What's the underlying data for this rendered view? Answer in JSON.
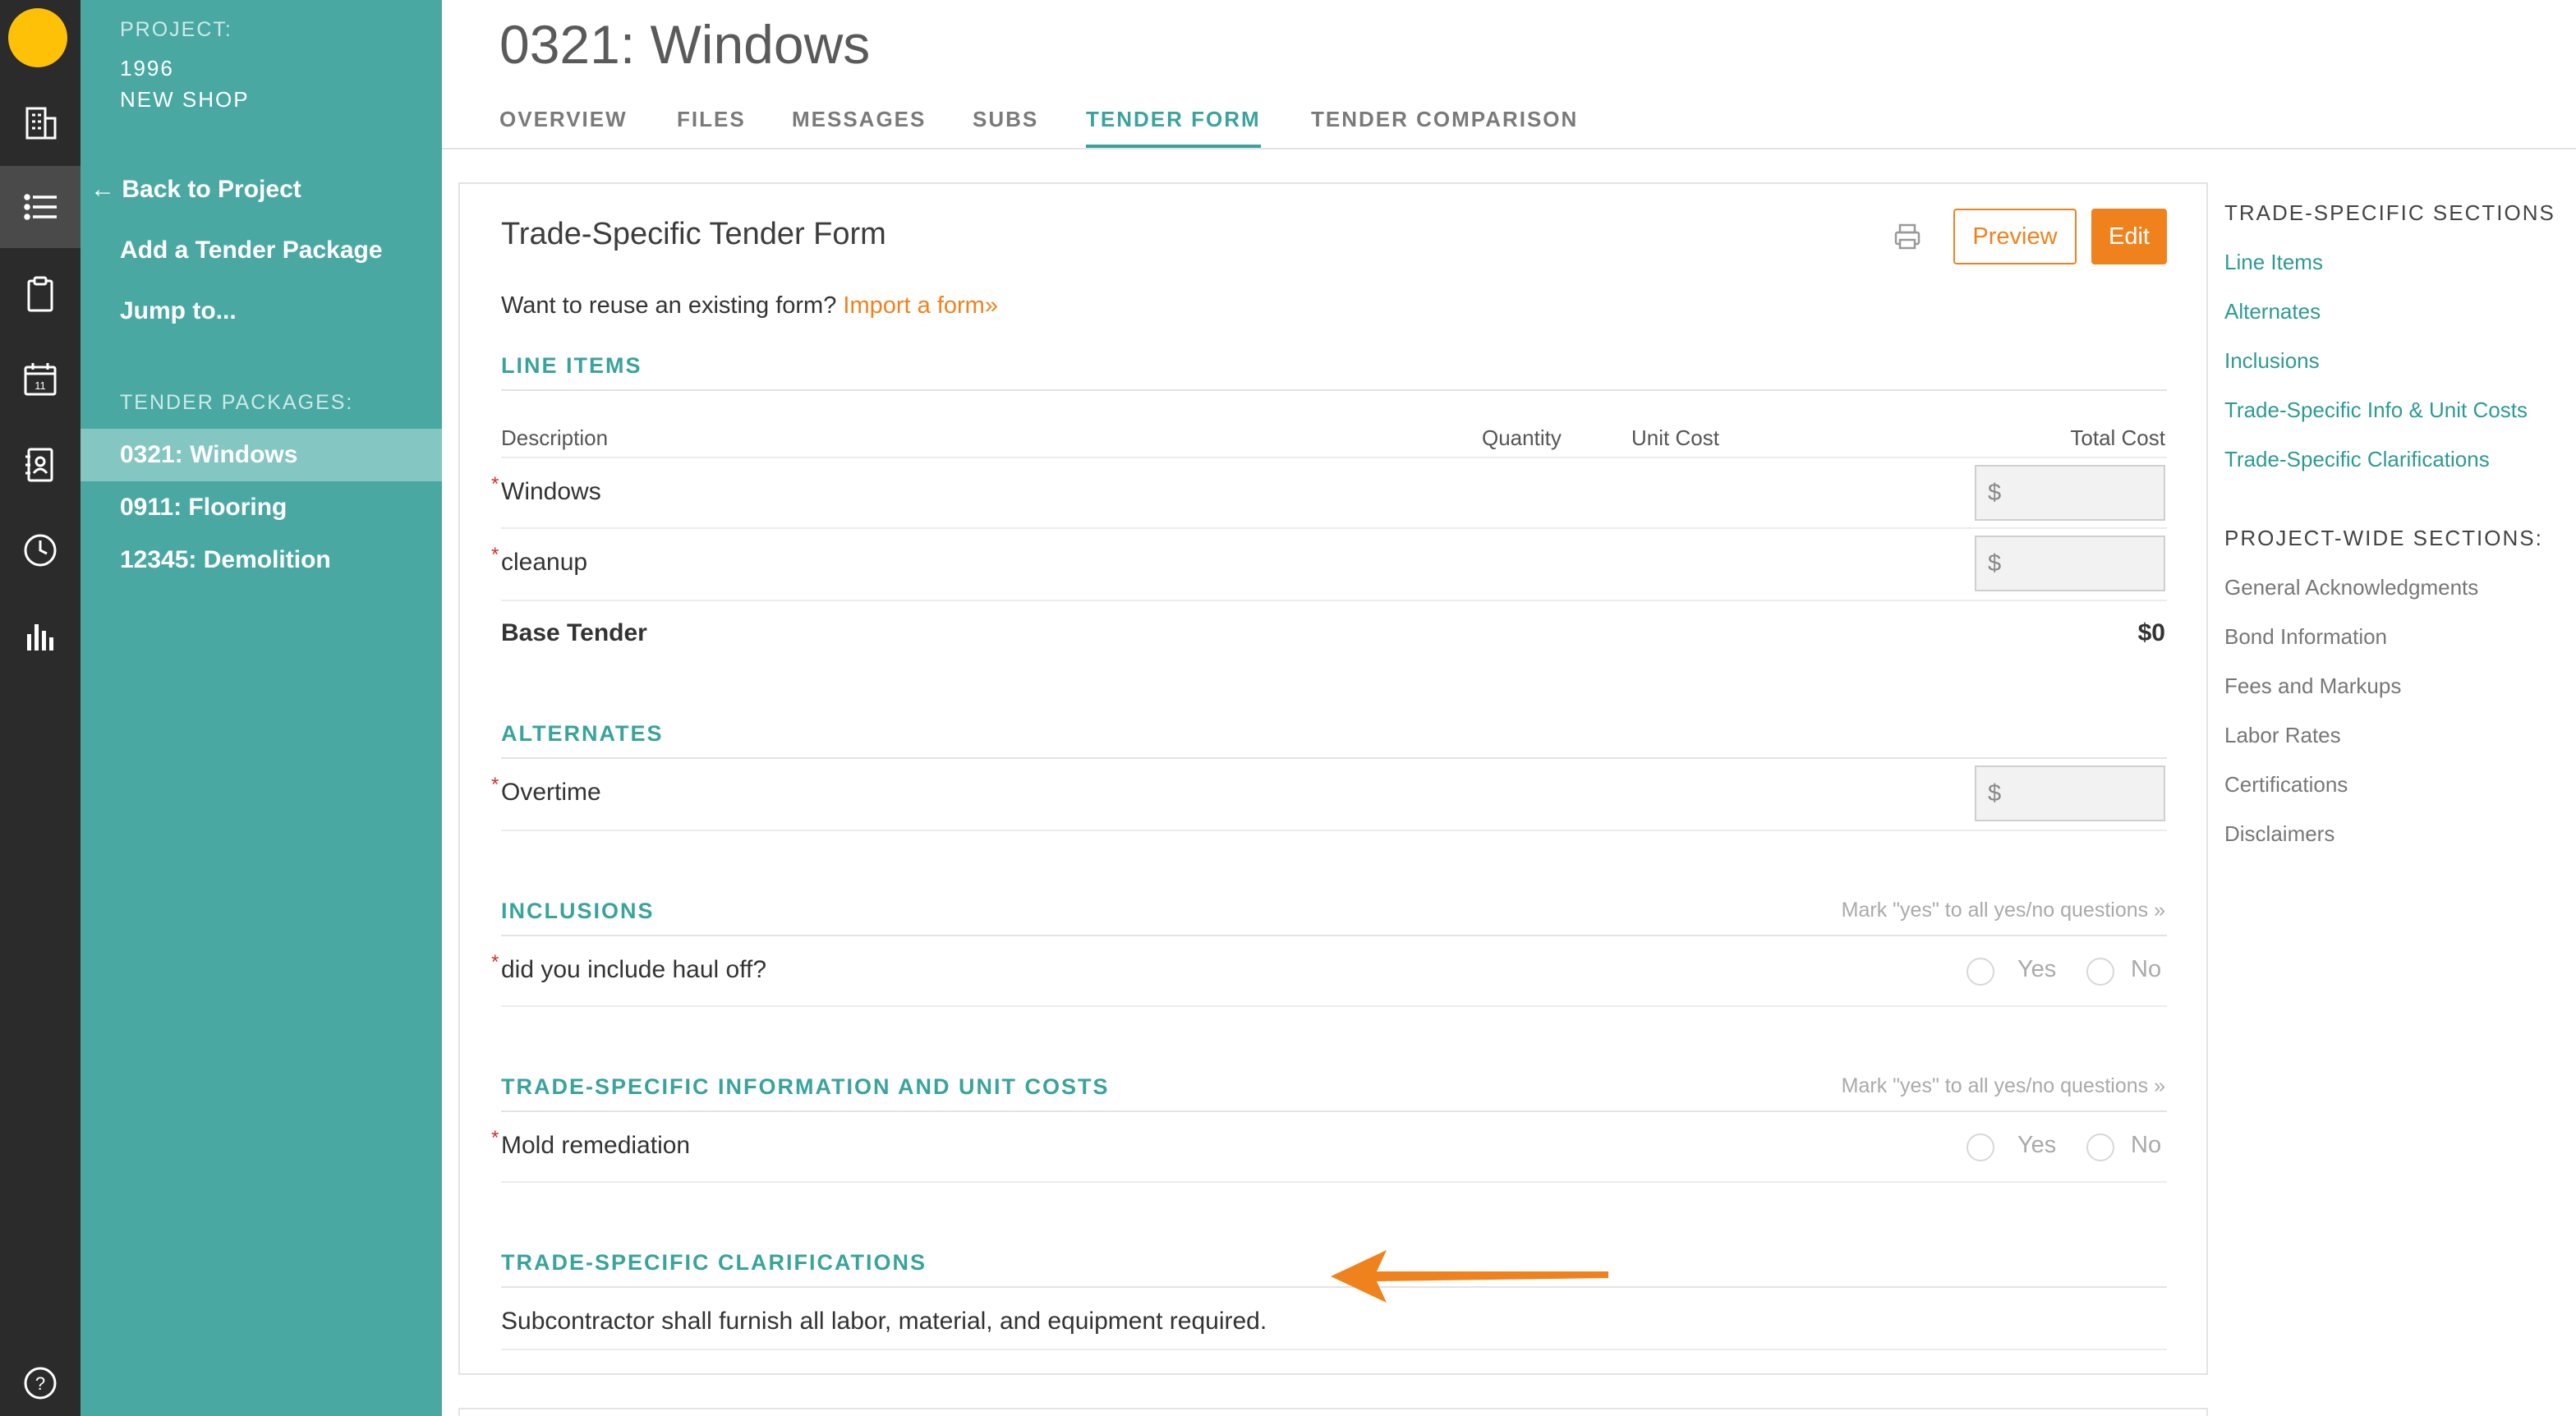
{
  "nav_rail": {
    "icons": [
      "logo-icon",
      "building-icon",
      "list-icon",
      "clipboard-icon",
      "calendar-icon",
      "address-book-icon",
      "clock-icon",
      "bar-chart-icon",
      "help-icon"
    ],
    "calendar_day": "11",
    "help_glyph": "?"
  },
  "sidebar": {
    "project_caption": "PROJECT:",
    "project_number": "1996",
    "project_name": "NEW SHOP",
    "back_arrow": "←",
    "back_label": "Back to Project",
    "add_package": "Add a Tender Package",
    "jump_to": "Jump to...",
    "packages_caption": "TENDER PACKAGES:",
    "packages": [
      {
        "label": "0321: Windows",
        "active": true
      },
      {
        "label": "0911: Flooring",
        "active": false
      },
      {
        "label": "12345: Demolition",
        "active": false
      }
    ]
  },
  "header": {
    "title": "0321: Windows",
    "tabs": [
      {
        "label": "OVERVIEW"
      },
      {
        "label": "FILES"
      },
      {
        "label": "MESSAGES"
      },
      {
        "label": "SUBS"
      },
      {
        "label": "TENDER FORM"
      },
      {
        "label": "TENDER COMPARISON"
      }
    ],
    "active_tab": "TENDER FORM"
  },
  "form": {
    "title": "Trade-Specific Tender Form",
    "preview_label": "Preview",
    "edit_label": "Edit",
    "reuse_text": "Want to reuse an existing form?",
    "import_link": "Import a form»",
    "line_items": {
      "heading": "LINE ITEMS",
      "columns": {
        "description": "Description",
        "quantity": "Quantity",
        "unit_cost": "Unit Cost",
        "total_cost": "Total Cost"
      },
      "rows": [
        {
          "label": "Windows",
          "required": "*",
          "currency": "$"
        },
        {
          "label": "cleanup",
          "required": "*",
          "currency": "$"
        }
      ],
      "base_label": "Base Tender",
      "base_value": "$0"
    },
    "alternates": {
      "heading": "ALTERNATES",
      "rows": [
        {
          "label": "Overtime",
          "required": "*",
          "currency": "$"
        }
      ]
    },
    "inclusions": {
      "heading": "INCLUSIONS",
      "mark_all": "Mark \"yes\" to all yes/no questions »",
      "rows": [
        {
          "label": "did you include haul off?",
          "required": "*",
          "yes": "Yes",
          "no": "No"
        }
      ]
    },
    "info_unit_costs": {
      "heading": "TRADE-SPECIFIC INFORMATION AND UNIT COSTS",
      "mark_all": "Mark \"yes\" to all yes/no questions »",
      "rows": [
        {
          "label": "Mold remediation",
          "required": "*",
          "yes": "Yes",
          "no": "No"
        }
      ]
    },
    "clarifications": {
      "heading": "TRADE-SPECIFIC CLARIFICATIONS",
      "text": "Subcontractor shall furnish all labor, material, and equipment required."
    },
    "accent_color": "#f0821e",
    "teal_color": "#3aa39c"
  },
  "toc": {
    "trade_caption": "TRADE-SPECIFIC SECTIONS",
    "trade_links": [
      "Line Items",
      "Alternates",
      "Inclusions",
      "Trade-Specific Info & Unit Costs",
      "Trade-Specific Clarifications"
    ],
    "project_caption": "PROJECT-WIDE SECTIONS:",
    "project_links": [
      "General Acknowledgments",
      "Bond Information",
      "Fees and Markups",
      "Labor Rates",
      "Certifications",
      "Disclaimers"
    ]
  }
}
